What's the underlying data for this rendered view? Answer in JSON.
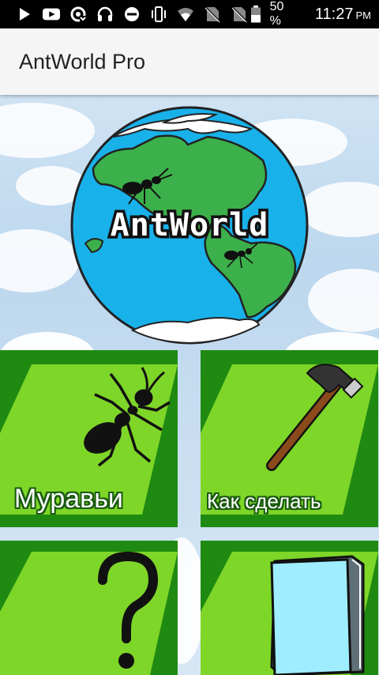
{
  "status_bar": {
    "battery_percent": "50 %",
    "time": "11:27",
    "ampm": "PM",
    "icons": [
      "play-icon",
      "youtube-icon",
      "sync-icon",
      "headset-icon",
      "do-not-disturb-icon",
      "vibrate-icon",
      "wifi-icon",
      "no-sim-icon",
      "no-sim-icon",
      "battery-icon"
    ]
  },
  "app_bar": {
    "title": "AntWorld Pro"
  },
  "hero": {
    "logo_text": "AntWorld"
  },
  "tiles": [
    {
      "label": "Муравьи",
      "icon": "ant-icon"
    },
    {
      "label": "Как сделать",
      "icon": "hammer-icon"
    },
    {
      "label": "",
      "icon": "question-mark-icon"
    },
    {
      "label": "",
      "icon": "book-icon"
    }
  ],
  "colors": {
    "tile_dark": "#1f8a12",
    "tile_light": "#7ed628",
    "ocean": "#1ab0ea",
    "land": "#3cb04a"
  }
}
